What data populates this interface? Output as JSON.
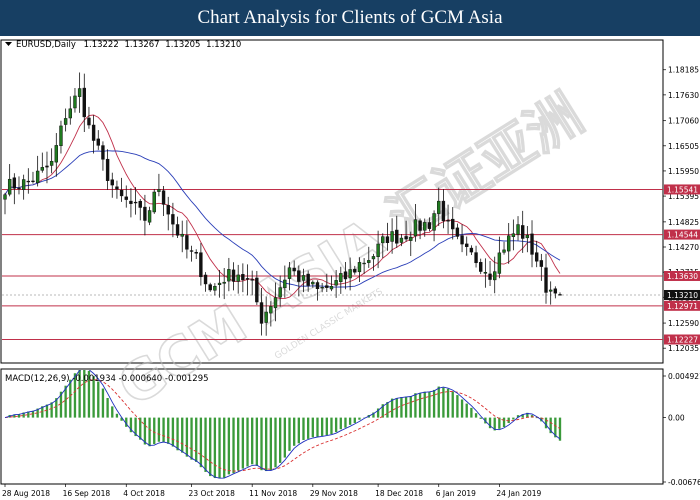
{
  "header": {
    "title": "Chart Analysis for Clients of GCM Asia"
  },
  "watermark": {
    "text": "GCM ASIA 汇证亚洲",
    "sub": "GOLDEN CLASSIC MARKETS",
    "color": "#c9c9c9"
  },
  "colors": {
    "bull": "#1f7a1f",
    "bear": "#111111",
    "red_ma": "#c0304a",
    "blue_ma": "#2b3fb8",
    "hline": "#c0304a",
    "macd_signal": "#d93030",
    "macd_line": "#1f2fbf",
    "macd_hist": "#3a9a3a",
    "label_red_bg": "#c0304a",
    "label_black_bg": "#111111"
  },
  "chart_data": [
    {
      "type": "candlestick",
      "title": "EURUSD,Daily",
      "symbol": "EURUSD",
      "timeframe": "Daily",
      "ohlc_header": [
        "1.13222",
        "1.13267",
        "1.13205",
        "1.13210"
      ],
      "ylim": [
        1.1173,
        1.1882
      ],
      "y_tick_labels": [
        "1.18185",
        "1.17630",
        "1.17060",
        "1.16505",
        "1.15950",
        "1.15395",
        "1.14825",
        "1.14270",
        "1.13715",
        "1.13160",
        "1.12590",
        "1.12035"
      ],
      "y_tick_values": [
        1.18185,
        1.1763,
        1.1706,
        1.16505,
        1.1595,
        1.15395,
        1.14825,
        1.1427,
        1.13715,
        1.1316,
        1.1259,
        1.12035
      ],
      "x_tick_labels": [
        "28 Aug 2018",
        "16 Sep 2018",
        "4 Oct 2018",
        "23 Oct 2018",
        "11 Nov 2018",
        "29 Nov 2018",
        "18 Dec 2018",
        "6 Jan 2019",
        "24 Jan 2019"
      ],
      "x_tick_index": [
        0,
        13,
        26,
        40,
        53,
        66,
        80,
        93,
        106
      ],
      "n_bars": 120,
      "price_lines": [
        {
          "value": 1.15541,
          "label": "1.15541",
          "style": "red"
        },
        {
          "value": 1.14544,
          "label": "1.14544",
          "style": "red"
        },
        {
          "value": 1.1363,
          "label": "1.13630",
          "style": "red"
        },
        {
          "value": 1.1321,
          "label": "1.13210",
          "style": "black"
        },
        {
          "value": 1.12971,
          "label": "1.12971",
          "style": "red"
        },
        {
          "value": 1.12227,
          "label": "1.12227",
          "style": "red"
        }
      ],
      "guide_closes": [
        [
          0,
          1.156
        ],
        [
          5,
          1.157
        ],
        [
          10,
          1.161
        ],
        [
          13,
          1.172
        ],
        [
          16,
          1.177
        ],
        [
          18,
          1.169
        ],
        [
          21,
          1.161
        ],
        [
          24,
          1.154
        ],
        [
          27,
          1.152
        ],
        [
          30,
          1.149
        ],
        [
          33,
          1.156
        ],
        [
          36,
          1.148
        ],
        [
          39,
          1.142
        ],
        [
          41,
          1.14
        ],
        [
          44,
          1.133
        ],
        [
          47,
          1.136
        ],
        [
          50,
          1.137
        ],
        [
          53,
          1.134
        ],
        [
          55,
          1.127
        ],
        [
          58,
          1.132
        ],
        [
          61,
          1.138
        ],
        [
          64,
          1.135
        ],
        [
          67,
          1.133
        ],
        [
          70,
          1.134
        ],
        [
          73,
          1.136
        ],
        [
          76,
          1.139
        ],
        [
          79,
          1.141
        ],
        [
          82,
          1.145
        ],
        [
          85,
          1.145
        ],
        [
          88,
          1.147
        ],
        [
          91,
          1.148
        ],
        [
          93,
          1.1525
        ],
        [
          95,
          1.147
        ],
        [
          98,
          1.142
        ],
        [
          101,
          1.14
        ],
        [
          104,
          1.137
        ],
        [
          107,
          1.143
        ],
        [
          110,
          1.147
        ],
        [
          112,
          1.144
        ],
        [
          114,
          1.14
        ],
        [
          116,
          1.134
        ],
        [
          118,
          1.1325
        ],
        [
          119,
          1.1321
        ]
      ]
    },
    {
      "type": "macd",
      "title": "MACD(12,26,9) -0.001934 -0.000640 -0.001295",
      "params": "MACD(12,26,9)",
      "values_text": [
        "-0.001934",
        "-0.000640",
        "-0.001295"
      ],
      "y_tick_labels": [
        "0.004921",
        "0.00",
        "-0.006760"
      ],
      "y_tick_values": [
        0.004921,
        0,
        -0.00676
      ],
      "ylim": [
        -0.00676,
        0.004921
      ]
    }
  ]
}
